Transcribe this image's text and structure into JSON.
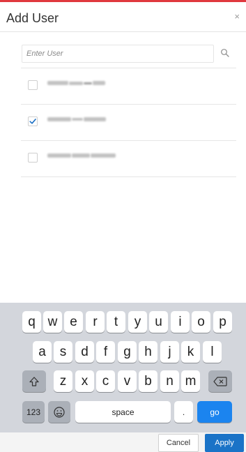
{
  "dialog": {
    "title": "Add User",
    "close_symbol": "×",
    "accent_color": "#e0383e"
  },
  "search": {
    "placeholder": "Enter User",
    "value": "",
    "icon": "search-icon"
  },
  "users": [
    {
      "name": "",
      "checked": false
    },
    {
      "name": "",
      "checked": true
    },
    {
      "name": "",
      "checked": false
    }
  ],
  "keyboard": {
    "row1": [
      "q",
      "w",
      "e",
      "r",
      "t",
      "y",
      "u",
      "i",
      "o",
      "p"
    ],
    "row2": [
      "a",
      "s",
      "d",
      "f",
      "g",
      "h",
      "j",
      "k",
      "l"
    ],
    "row3": [
      "z",
      "x",
      "c",
      "v",
      "b",
      "n",
      "m"
    ],
    "shift_icon": "shift-icon",
    "backspace_icon": "backspace-icon",
    "numbers_key": "123",
    "emoji_icon": "emoji-icon",
    "space_key": "space",
    "period_key": ".",
    "go_key": "go"
  },
  "footer": {
    "cancel_label": "Cancel",
    "apply_label": "Apply",
    "apply_color": "#1a73c7"
  }
}
